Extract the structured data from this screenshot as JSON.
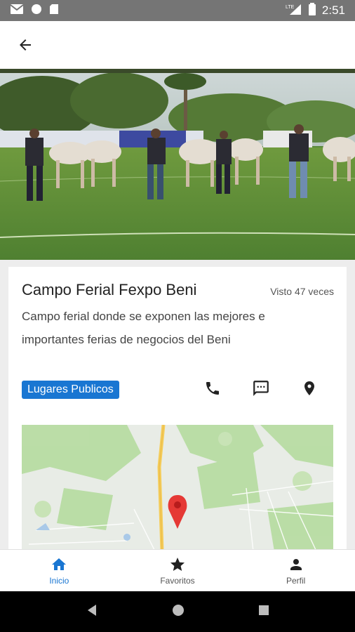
{
  "status_bar": {
    "time": "2:51",
    "network": "LTE",
    "icons": [
      "gmail-icon",
      "circle-icon",
      "sd-card-icon",
      "signal-icon",
      "battery-icon"
    ]
  },
  "app_bar": {
    "back_icon": "arrow-back-icon"
  },
  "hero": {
    "description": "photo"
  },
  "place": {
    "title": "Campo Ferial Fexpo Beni",
    "views": "Visto 47 veces",
    "description": "Campo ferial donde se exponen las mejores e importantes ferias de negocios del Beni",
    "category": "Lugares Publicos"
  },
  "actions": [
    "phone-icon",
    "message-icon",
    "location-icon"
  ],
  "bottom_nav": {
    "items": [
      {
        "label": "Inicio",
        "icon": "home-icon",
        "active": true
      },
      {
        "label": "Favoritos",
        "icon": "star-icon",
        "active": false
      },
      {
        "label": "Perfil",
        "icon": "person-icon",
        "active": false
      }
    ]
  },
  "colors": {
    "accent": "#1976d2",
    "pin": "#e53935",
    "status_bar": "#757575"
  }
}
